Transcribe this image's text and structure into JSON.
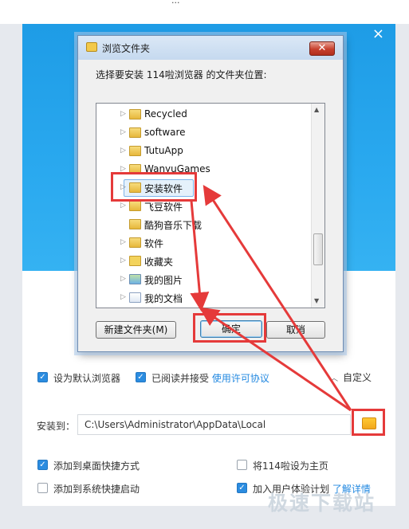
{
  "top_strip_text": "...",
  "installer": {
    "close_glyph": "×",
    "options": {
      "default_browser": "设为默认浏览器",
      "agree_prefix": "已阅读并接受",
      "agree_link": "使用许可协议",
      "custom": "自定义",
      "install_to_label": "安装到：",
      "install_path": "C:\\Users\\Administrator\\AppData\\Local",
      "desktop_shortcut": "添加到桌面快捷方式",
      "set_homepage": "将114啦设为主页",
      "quicklaunch": "添加到系统快捷启动",
      "join_program": "加入用户体验计划",
      "learn_more": "了解详情"
    }
  },
  "dialog": {
    "title": "浏览文件夹",
    "close_glyph": "✕",
    "prompt": "选择要安装 114啦浏览器 的文件夹位置:",
    "tree": [
      {
        "label": "Recycled",
        "expandable": true,
        "icon": "folder"
      },
      {
        "label": "software",
        "expandable": true,
        "icon": "folder"
      },
      {
        "label": "TutuApp",
        "expandable": true,
        "icon": "folder"
      },
      {
        "label": "WanyuGames",
        "expandable": true,
        "icon": "folder"
      },
      {
        "label": "安装软件",
        "expandable": true,
        "icon": "folder",
        "selected": true
      },
      {
        "label": "飞豆软件",
        "expandable": true,
        "icon": "folder"
      },
      {
        "label": "酷狗音乐下载",
        "expandable": false,
        "icon": "folder"
      },
      {
        "label": "软件",
        "expandable": true,
        "icon": "folder"
      },
      {
        "label": "收藏夹",
        "expandable": true,
        "icon": "favorites"
      },
      {
        "label": "我的图片",
        "expandable": true,
        "icon": "pictures"
      },
      {
        "label": "我的文档",
        "expandable": true,
        "icon": "documents"
      }
    ],
    "buttons": {
      "new_folder": "新建文件夹(M)",
      "ok": "确定",
      "cancel": "取消"
    }
  },
  "watermark": "极速下载站",
  "colors": {
    "annotation": "#e53a3a",
    "banner": "#2aa9ef",
    "accent": "#2b8ce0"
  }
}
